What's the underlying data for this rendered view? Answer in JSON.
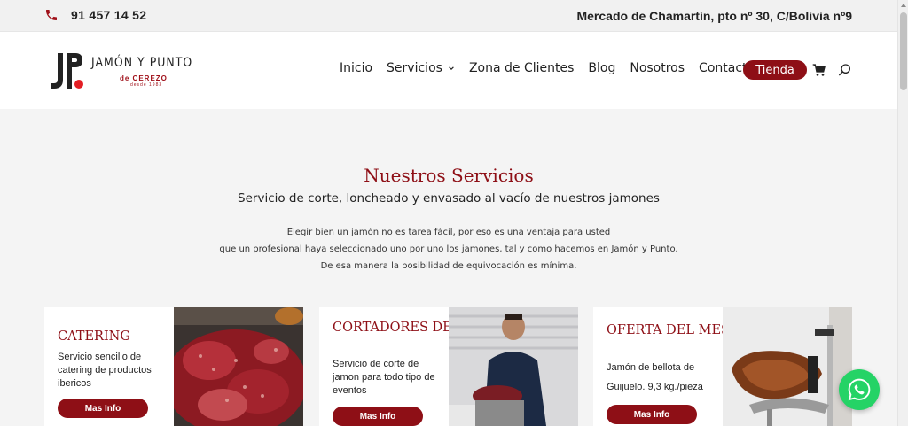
{
  "topbar": {
    "phone": "91 457 14 52",
    "address": "Mercado de Chamartín, pto nº 30, C/Bolivia nº9",
    "phone_icon": "phone-icon"
  },
  "logo": {
    "title": "JAMÓN Y PUNTO",
    "sub": "de CEREZO",
    "sub2": "desde 1983"
  },
  "nav": {
    "items": [
      "Inicio",
      "Servicios",
      "Zona de Clientes",
      "Blog",
      "Nosotros",
      "Contacto"
    ],
    "tienda": "Tienda",
    "cart_icon": "cart-icon",
    "search_icon": "search-icon"
  },
  "section": {
    "title": "Nuestros Servicios",
    "subtitle": "Servicio de corte, loncheado y envasado al vacío de nuestros jamones",
    "intro": [
      "Elegir bien un jamón no es tarea fácil, por eso es una ventaja para usted",
      "que un profesional haya seleccionado uno por uno los jamones, tal y como hacemos en Jamón y Punto.",
      "De esa manera la posibilidad de equivocación es mínima."
    ]
  },
  "cards": [
    {
      "title": "CATERING",
      "text": "Servicio sencillo de catering de productos ibericos",
      "button": "Mas Info"
    },
    {
      "title": "CORTADORES DE JAMON",
      "text": "Servicio de corte de jamon para todo tipo de eventos",
      "button": "Mas Info"
    },
    {
      "title": "OFERTA DEL MES",
      "text": "Jamón de bellota de Guijuelo. 9,3 kg./pieza",
      "button": "Mas Info"
    }
  ],
  "colors": {
    "brand": "#8e0f16",
    "whatsapp": "#25d366"
  },
  "whatsapp_icon": "whatsapp-icon"
}
